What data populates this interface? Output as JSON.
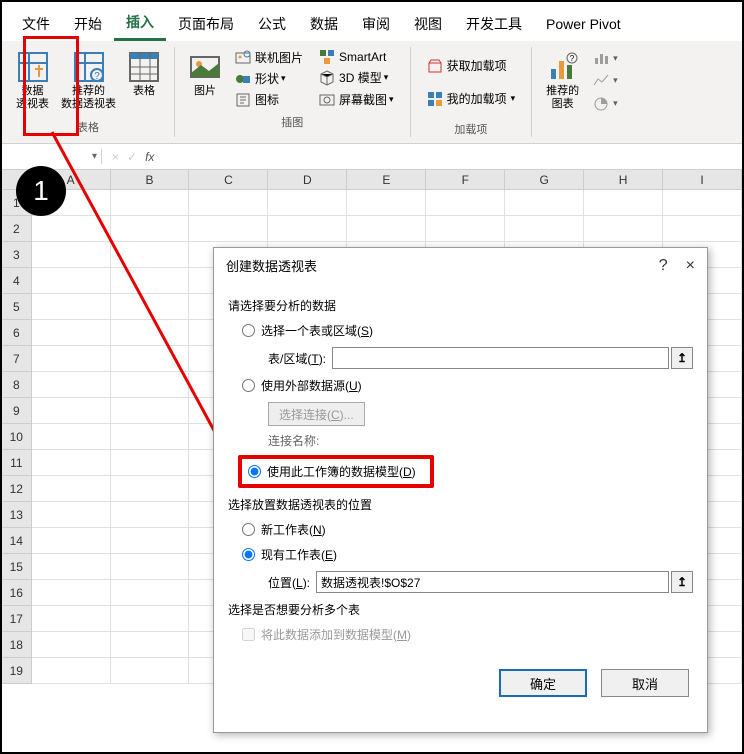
{
  "tabs": [
    "文件",
    "开始",
    "插入",
    "页面布局",
    "公式",
    "数据",
    "审阅",
    "视图",
    "开发工具",
    "Power Pivot"
  ],
  "active_tab_index": 2,
  "ribbon": {
    "group_tables": {
      "pivot": "数据\n透视表",
      "recommended_pivot": "推荐的\n数据透视表",
      "table": "表格",
      "label": "表格"
    },
    "group_illustrations": {
      "pictures": "图片",
      "online_pictures": "联机图片",
      "shapes": "形状",
      "icons": "图标",
      "smartart": "SmartArt",
      "model3d": "3D 模型",
      "screenshot": "屏幕截图",
      "label": "插图"
    },
    "group_addins": {
      "get_addins": "获取加载项",
      "my_addins": "我的加载项",
      "label": "加载项"
    },
    "group_charts": {
      "recommended": "推荐的\n图表"
    }
  },
  "step_number": "1",
  "formula_bar": {
    "fx": "fx"
  },
  "columns": [
    "A",
    "B",
    "C",
    "D",
    "E",
    "F",
    "G",
    "H",
    "I"
  ],
  "rows": [
    "1",
    "2",
    "3",
    "4",
    "5",
    "6",
    "7",
    "8",
    "9",
    "10",
    "11",
    "12",
    "13",
    "14",
    "15",
    "16",
    "17",
    "18",
    "19"
  ],
  "dialog": {
    "title": "创建数据透视表",
    "help": "?",
    "close": "×",
    "section1_label": "请选择要分析的数据",
    "radio_select_range": "选择一个表或区域(S)",
    "field_table_range_label": "表/区域(T):",
    "radio_external": "使用外部数据源(U)",
    "btn_choose_connection": "选择连接(C)...",
    "connection_name_label": "连接名称:",
    "radio_data_model": "使用此工作簿的数据模型(D)",
    "section2_label": "选择放置数据透视表的位置",
    "radio_new_sheet": "新工作表(N)",
    "radio_existing_sheet": "现有工作表(E)",
    "field_location_label": "位置(L):",
    "field_location_value": "数据透视表!$O$27",
    "section3_label": "选择是否想要分析多个表",
    "checkbox_add_to_model": "将此数据添加到数据模型(M)",
    "btn_ok": "确定",
    "btn_cancel": "取消"
  }
}
